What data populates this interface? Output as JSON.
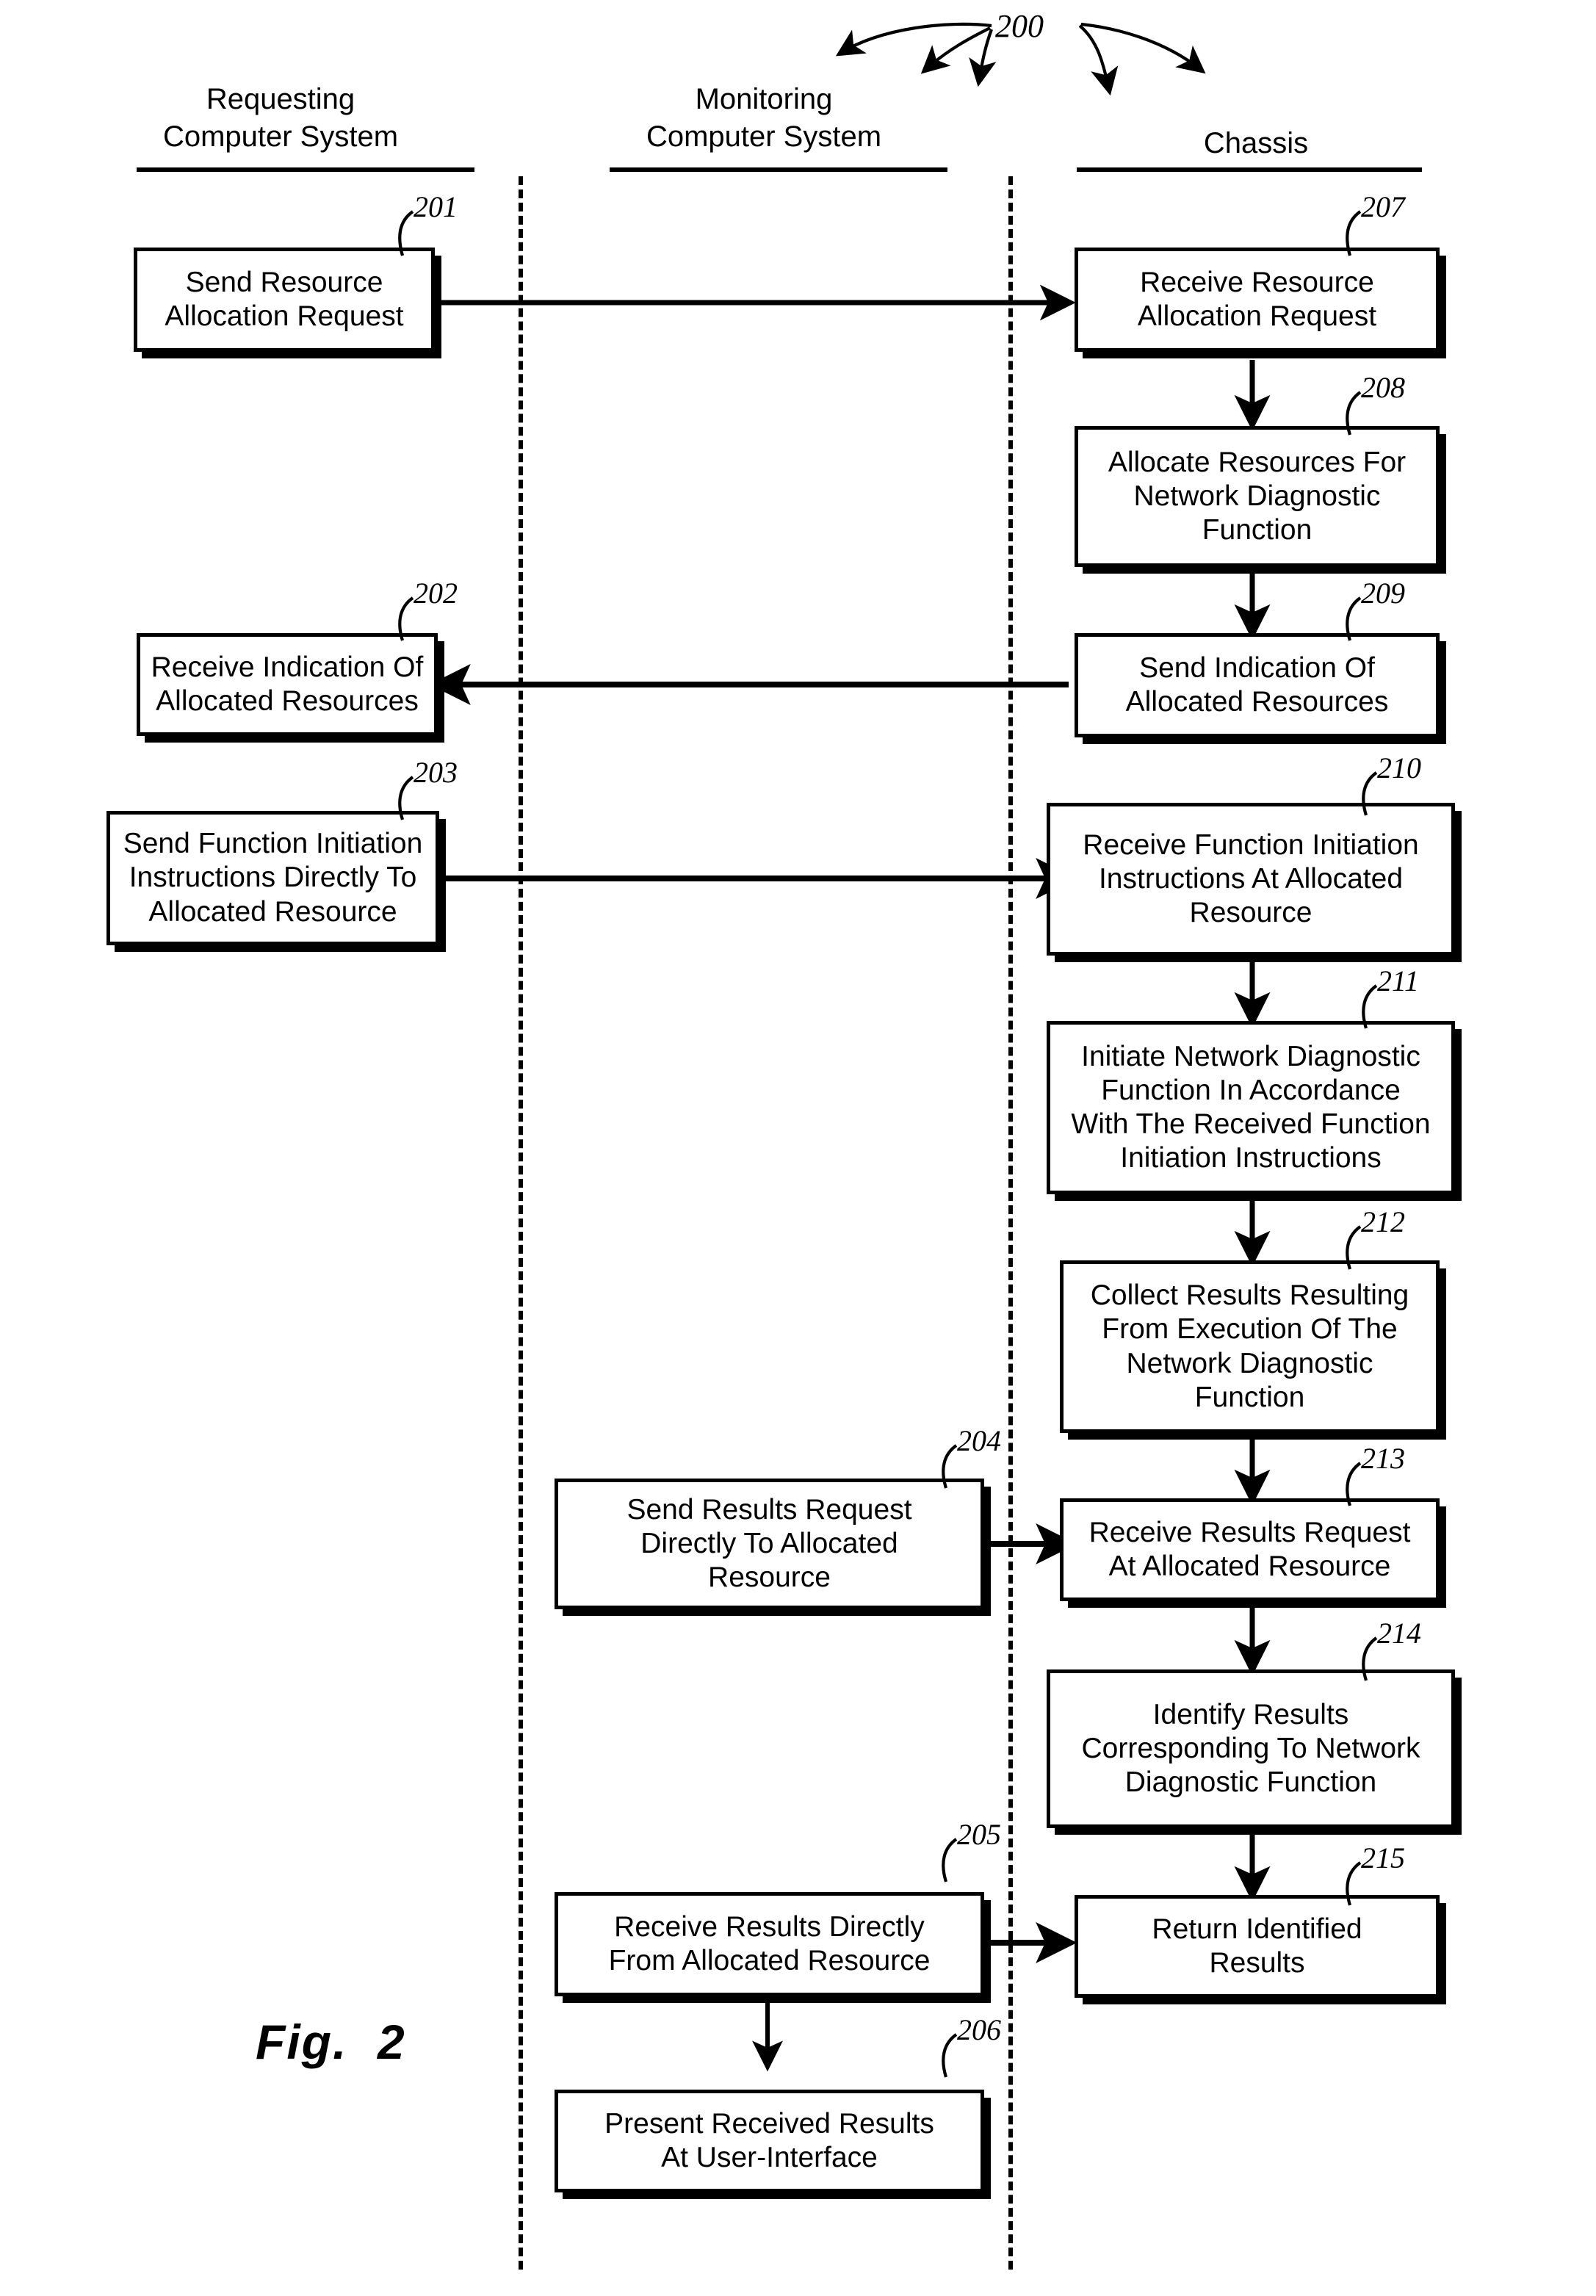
{
  "figure": {
    "caption": "Fig.  2",
    "overall_ref": "200"
  },
  "lanes": [
    {
      "id": "requesting",
      "title": "Requesting\nComputer System"
    },
    {
      "id": "monitoring",
      "title": "Monitoring\nComputer System"
    },
    {
      "id": "chassis",
      "title": "Chassis"
    }
  ],
  "steps": [
    {
      "ref": "201",
      "lane": "requesting",
      "label": "Send Resource\nAllocation Request"
    },
    {
      "ref": "202",
      "lane": "requesting",
      "label": "Receive Indication Of\nAllocated Resources"
    },
    {
      "ref": "203",
      "lane": "requesting",
      "label": "Send Function Initiation\nInstructions Directly To\nAllocated Resource"
    },
    {
      "ref": "204",
      "lane": "monitoring",
      "label": "Send Results Request\nDirectly To Allocated\nResource"
    },
    {
      "ref": "205",
      "lane": "monitoring",
      "label": "Receive Results Directly\nFrom Allocated Resource"
    },
    {
      "ref": "206",
      "lane": "monitoring",
      "label": "Present Received Results\nAt User-Interface"
    },
    {
      "ref": "207",
      "lane": "chassis",
      "label": "Receive Resource\nAllocation Request"
    },
    {
      "ref": "208",
      "lane": "chassis",
      "label": "Allocate Resources For\nNetwork Diagnostic\nFunction"
    },
    {
      "ref": "209",
      "lane": "chassis",
      "label": "Send Indication Of\nAllocated Resources"
    },
    {
      "ref": "210",
      "lane": "chassis",
      "label": "Receive Function Initiation\nInstructions At Allocated\nResource"
    },
    {
      "ref": "211",
      "lane": "chassis",
      "label": "Initiate Network Diagnostic\nFunction In Accordance\nWith The Received Function\nInitiation Instructions"
    },
    {
      "ref": "212",
      "lane": "chassis",
      "label": "Collect Results Resulting\nFrom Execution Of The\nNetwork Diagnostic\nFunction"
    },
    {
      "ref": "213",
      "lane": "chassis",
      "label": "Receive Results Request\nAt Allocated Resource"
    },
    {
      "ref": "214",
      "lane": "chassis",
      "label": "Identify Results\nCorresponding To Network\nDiagnostic Function"
    },
    {
      "ref": "215",
      "lane": "chassis",
      "label": "Return Identified\nResults"
    }
  ],
  "colors": {
    "ink": "#000000",
    "paper": "#ffffff"
  }
}
